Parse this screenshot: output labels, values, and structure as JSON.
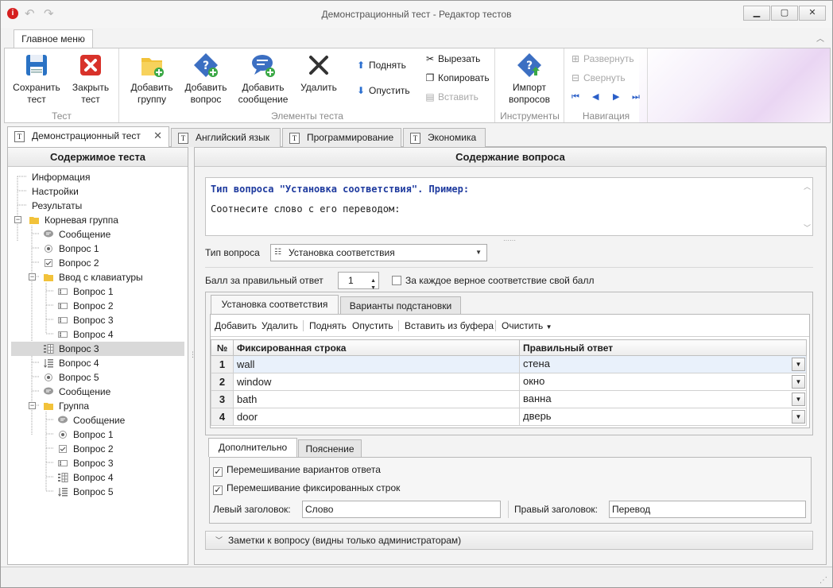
{
  "window": {
    "title": "Демонстрационный тест - Редактор тестов"
  },
  "ribbon": {
    "main_tab": "Главное меню",
    "groups": {
      "test": {
        "label": "Тест",
        "save": "Сохранить\nтест",
        "close": "Закрыть\nтест"
      },
      "elements": {
        "label": "Элементы теста",
        "add_group": "Добавить\nгруппу",
        "add_question": "Добавить\nвопрос",
        "add_message": "Добавить\nсообщение",
        "delete": "Удалить",
        "up": "Поднять",
        "down": "Опустить",
        "cut": "Вырезать",
        "copy": "Копировать",
        "paste": "Вставить"
      },
      "tools": {
        "label": "Инструменты",
        "import": "Импорт\nвопросов"
      },
      "navigation": {
        "label": "Навигация",
        "expand": "Развернуть",
        "collapse": "Свернуть"
      }
    }
  },
  "doc_tabs": [
    "Демонстрационный тест",
    "Английский язык",
    "Программирование",
    "Экономика"
  ],
  "left_panel": {
    "title": "Содержимое теста",
    "tree": [
      {
        "label": "Информация",
        "level": 0,
        "icon": "none"
      },
      {
        "label": "Настройки",
        "level": 0,
        "icon": "none"
      },
      {
        "label": "Результаты",
        "level": 0,
        "icon": "none"
      },
      {
        "label": "Корневая группа",
        "level": 0,
        "icon": "folder-icon",
        "expander": "−"
      },
      {
        "label": "Сообщение",
        "level": 1,
        "icon": "message-icon"
      },
      {
        "label": "Вопрос 1",
        "level": 1,
        "icon": "radio-icon"
      },
      {
        "label": "Вопрос 2",
        "level": 1,
        "icon": "checkbox-icon"
      },
      {
        "label": "Ввод с клавиатуры",
        "level": 1,
        "icon": "folder-icon",
        "expander": "−"
      },
      {
        "label": "Вопрос 1",
        "level": 2,
        "icon": "text-input-icon"
      },
      {
        "label": "Вопрос 2",
        "level": 2,
        "icon": "text-input-icon"
      },
      {
        "label": "Вопрос 3",
        "level": 2,
        "icon": "text-input-icon"
      },
      {
        "label": "Вопрос 4",
        "level": 2,
        "icon": "text-input-icon"
      },
      {
        "label": "Вопрос 3",
        "level": 1,
        "icon": "matching-icon",
        "selected": true
      },
      {
        "label": "Вопрос 4",
        "level": 1,
        "icon": "ordering-icon"
      },
      {
        "label": "Вопрос 5",
        "level": 1,
        "icon": "radio-icon"
      },
      {
        "label": "Сообщение",
        "level": 1,
        "icon": "message-icon"
      },
      {
        "label": "Группа",
        "level": 1,
        "icon": "folder-icon",
        "expander": "−"
      },
      {
        "label": "Сообщение",
        "level": 2,
        "icon": "message-icon"
      },
      {
        "label": "Вопрос 1",
        "level": 2,
        "icon": "radio-icon"
      },
      {
        "label": "Вопрос 2",
        "level": 2,
        "icon": "checkbox-icon"
      },
      {
        "label": "Вопрос 3",
        "level": 2,
        "icon": "text-input-icon"
      },
      {
        "label": "Вопрос 4",
        "level": 2,
        "icon": "matching-icon"
      },
      {
        "label": "Вопрос 5",
        "level": 2,
        "icon": "ordering-icon"
      }
    ]
  },
  "right_panel": {
    "title": "Содержание вопроса",
    "question_title": "Тип вопроса \"Установка соответствия\". Пример:",
    "question_text": "Соотнесите слово с его переводом:",
    "type_label": "Тип вопроса",
    "type_value": "Установка соответствия",
    "score_label": "Балл за правильный ответ",
    "score_value": "1",
    "per_match_label": "За каждое верное соответствие свой балл",
    "tabs": [
      "Установка соответствия",
      "Варианты подстановки"
    ],
    "toolbar": {
      "add": "Добавить",
      "delete": "Удалить",
      "up": "Поднять",
      "down": "Опустить",
      "paste_buffer": "Вставить из буфера",
      "clear": "Очистить"
    },
    "grid": {
      "headers": [
        "№",
        "Фиксированная строка",
        "Правильный ответ"
      ],
      "rows": [
        {
          "num": "1",
          "fixed": "wall",
          "answer": "стена"
        },
        {
          "num": "2",
          "fixed": "window",
          "answer": "окно"
        },
        {
          "num": "3",
          "fixed": "bath",
          "answer": "ванна"
        },
        {
          "num": "4",
          "fixed": "door",
          "answer": "дверь"
        }
      ]
    },
    "extra_tabs": [
      "Дополнительно",
      "Пояснение"
    ],
    "shuffle_answers": "Перемешивание вариантов ответа",
    "shuffle_fixed": "Перемешивание фиксированных строк",
    "left_header_label": "Левый заголовок:",
    "left_header_value": "Слово",
    "right_header_label": "Правый заголовок:",
    "right_header_value": "Перевод",
    "notes": "Заметки к вопросу (видны только администраторам)"
  }
}
